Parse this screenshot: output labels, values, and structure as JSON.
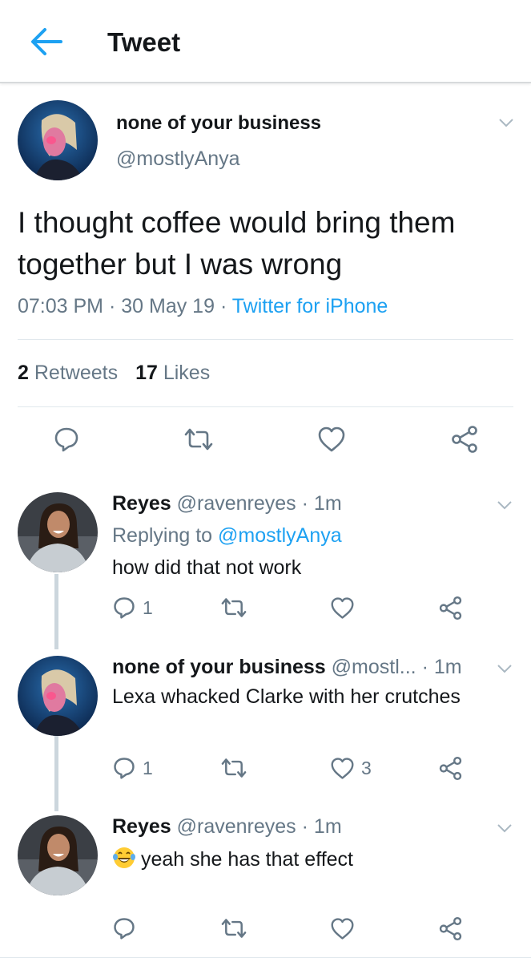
{
  "header": {
    "title": "Tweet",
    "back_icon": "arrow-left-icon",
    "accent": "#1da1f2"
  },
  "tweet": {
    "author_name": "none of your business",
    "author_handle": "@mostlyAnya",
    "text": "I thought coffee would bring them together but I was wrong",
    "time": "07:03 PM",
    "date": "30 May 19",
    "source": "Twitter for iPhone",
    "retweets_count": "2",
    "retweets_label": "Retweets",
    "likes_count": "17",
    "likes_label": "Likes"
  },
  "replies": [
    {
      "name": "Reyes",
      "handle": "@ravenreyes",
      "time": "1m",
      "replying_prefix": "Replying to",
      "replying_to": "@mostlyAnya",
      "text": "how did that not work",
      "reply_count": "1",
      "retweet_count": "",
      "like_count": ""
    },
    {
      "name": "none of your business",
      "handle": "@mostl...",
      "time": "1m",
      "text": "Lexa whacked Clarke with her crutches",
      "reply_count": "1",
      "retweet_count": "",
      "like_count": "3"
    },
    {
      "name": "Reyes",
      "handle": "@ravenreyes",
      "time": "1m",
      "emoji": "laughing-tears-emoji",
      "text": "yeah she has that effect",
      "reply_count": "",
      "retweet_count": "",
      "like_count": ""
    }
  ],
  "separator": "·",
  "colors": {
    "text": "#14171a",
    "secondary": "#657786",
    "link": "#1da1f2",
    "icon": "#657786",
    "divider": "#e1e8ed"
  }
}
